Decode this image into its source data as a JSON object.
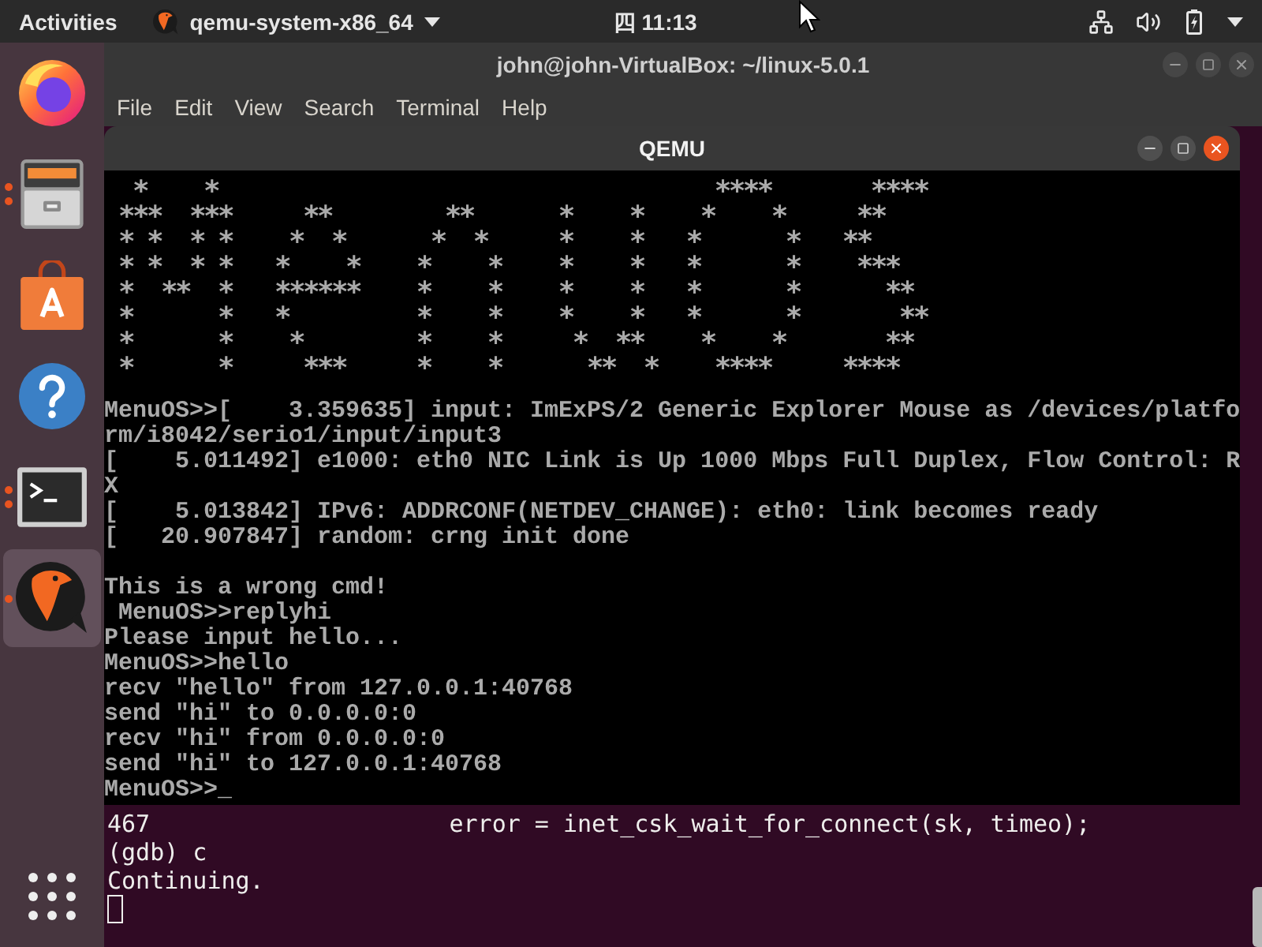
{
  "top_bar": {
    "activities": "Activities",
    "app_menu": "qemu-system-x86_64",
    "clock": "四 11:13"
  },
  "dock": {
    "items": [
      {
        "kind": "firefox",
        "running": false,
        "multiple_windows": false,
        "selected": false
      },
      {
        "kind": "files",
        "running": true,
        "multiple_windows": true,
        "selected": false
      },
      {
        "kind": "software",
        "running": false,
        "multiple_windows": false,
        "selected": false
      },
      {
        "kind": "help",
        "running": false,
        "multiple_windows": false,
        "selected": false
      },
      {
        "kind": "terminal",
        "running": true,
        "multiple_windows": true,
        "selected": false
      },
      {
        "kind": "qemu",
        "running": true,
        "multiple_windows": false,
        "selected": true
      }
    ]
  },
  "terminal": {
    "title": "john@john-VirtualBox: ~/linux-5.0.1",
    "menu": [
      "File",
      "Edit",
      "View",
      "Search",
      "Terminal",
      "Help"
    ],
    "lines": [
      "467                     error = inet_csk_wait_for_connect(sk, timeo);",
      "(gdb) c",
      "Continuing."
    ]
  },
  "qemu": {
    "title": "QEMU",
    "banner": "  *    *                                   ****       ****\n ***  ***     **        **      *    *    *    *     **\n * *  * *    *  *      *  *     *    *   *      *   **\n * *  * *   *    *    *    *    *    *   *      *    ***\n *  **  *   ******    *    *    *    *   *      *      **\n *      *   *         *    *    *    *   *      *       **\n *      *    *        *    *     *  **    *    *       **\n *      *     ***     *    *      **  *    ****     ****",
    "log": [
      "MenuOS>>[    3.359635] input: ImExPS/2 Generic Explorer Mouse as /devices/platfo",
      "rm/i8042/serio1/input/input3",
      "[    5.011492] e1000: eth0 NIC Link is Up 1000 Mbps Full Duplex, Flow Control: R",
      "X",
      "[    5.013842] IPv6: ADDRCONF(NETDEV_CHANGE): eth0: link becomes ready",
      "[   20.907847] random: crng init done"
    ],
    "session": [
      "This is a wrong cmd!",
      " MenuOS>>replyhi",
      "Please input hello...",
      "MenuOS>>hello",
      "recv \"hello\" from 127.0.0.1:40768",
      "send \"hi\" to 0.0.0.0:0",
      "recv \"hi\" from 0.0.0.0:0",
      "send \"hi\" to 127.0.0.1:40768",
      "MenuOS>>_"
    ]
  }
}
